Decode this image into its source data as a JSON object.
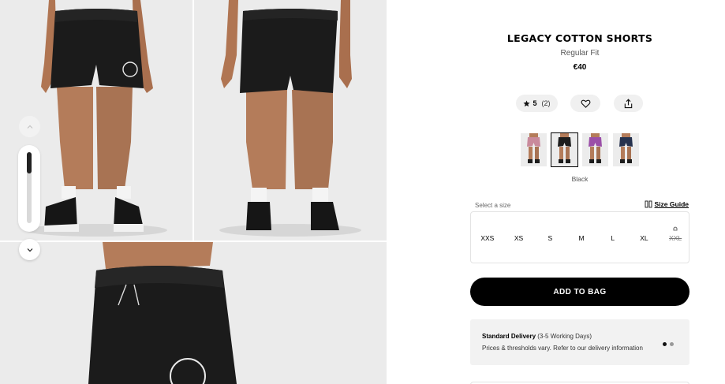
{
  "product": {
    "title": "LEGACY COTTON SHORTS",
    "fit": "Regular Fit",
    "price": "€40"
  },
  "rating": {
    "stars": "5",
    "count": "(2)",
    "icon": "star-icon"
  },
  "actions": {
    "wishlist_icon": "heart-icon",
    "share_icon": "share-icon"
  },
  "colors": {
    "options": [
      {
        "name": "Pink",
        "hex": "#c98a9c"
      },
      {
        "name": "Black",
        "hex": "#1d1d1d"
      },
      {
        "name": "Purple",
        "hex": "#9b4fa8"
      },
      {
        "name": "Navy",
        "hex": "#26324e"
      }
    ],
    "selected_name": "Black"
  },
  "sizes": {
    "label": "Select a size",
    "guide_label": "Size Guide",
    "options": [
      {
        "label": "XXS",
        "available": true
      },
      {
        "label": "XS",
        "available": true
      },
      {
        "label": "S",
        "available": true
      },
      {
        "label": "M",
        "available": true
      },
      {
        "label": "L",
        "available": true
      },
      {
        "label": "XL",
        "available": true
      },
      {
        "label": "XXL",
        "available": false
      }
    ]
  },
  "cta": {
    "add_to_bag": "ADD TO BAG"
  },
  "delivery": {
    "title": "Standard Delivery",
    "subtitle": "(3-5 Working Days)",
    "body": "Prices & thresholds vary. Refer to our delivery information",
    "active_slide": 1,
    "slide_count": 2
  },
  "gallery": {
    "scroll_fraction": 0.3,
    "up_icon": "chevron-up-icon",
    "down_icon": "chevron-down-icon"
  },
  "colors_ui": {
    "accent": "#000000",
    "panel_bg": "#f2f2f2",
    "photo_bg": "#e9e9e9",
    "garment": "#1b1b1b",
    "skin": "#b47c5a"
  }
}
